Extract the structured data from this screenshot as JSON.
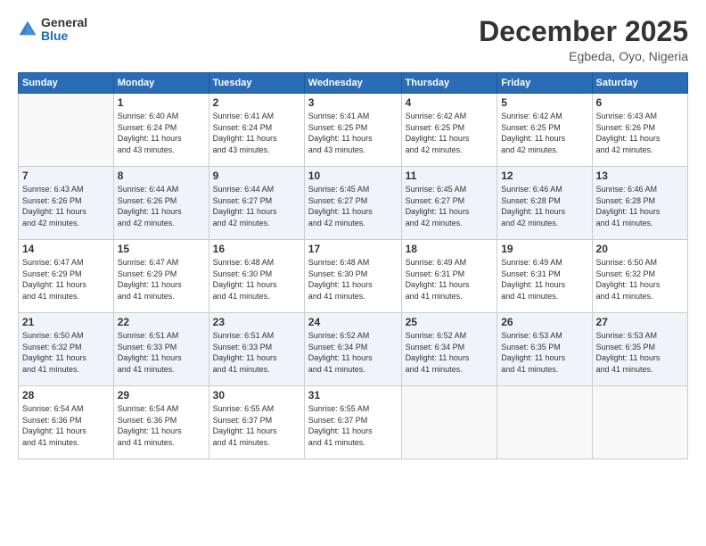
{
  "header": {
    "logo_general": "General",
    "logo_blue": "Blue",
    "month_title": "December 2025",
    "location": "Egbeda, Oyo, Nigeria"
  },
  "days_of_week": [
    "Sunday",
    "Monday",
    "Tuesday",
    "Wednesday",
    "Thursday",
    "Friday",
    "Saturday"
  ],
  "weeks": [
    [
      {
        "day": "",
        "info": ""
      },
      {
        "day": "1",
        "info": "Sunrise: 6:40 AM\nSunset: 6:24 PM\nDaylight: 11 hours\nand 43 minutes."
      },
      {
        "day": "2",
        "info": "Sunrise: 6:41 AM\nSunset: 6:24 PM\nDaylight: 11 hours\nand 43 minutes."
      },
      {
        "day": "3",
        "info": "Sunrise: 6:41 AM\nSunset: 6:25 PM\nDaylight: 11 hours\nand 43 minutes."
      },
      {
        "day": "4",
        "info": "Sunrise: 6:42 AM\nSunset: 6:25 PM\nDaylight: 11 hours\nand 42 minutes."
      },
      {
        "day": "5",
        "info": "Sunrise: 6:42 AM\nSunset: 6:25 PM\nDaylight: 11 hours\nand 42 minutes."
      },
      {
        "day": "6",
        "info": "Sunrise: 6:43 AM\nSunset: 6:26 PM\nDaylight: 11 hours\nand 42 minutes."
      }
    ],
    [
      {
        "day": "7",
        "info": "Sunrise: 6:43 AM\nSunset: 6:26 PM\nDaylight: 11 hours\nand 42 minutes."
      },
      {
        "day": "8",
        "info": "Sunrise: 6:44 AM\nSunset: 6:26 PM\nDaylight: 11 hours\nand 42 minutes."
      },
      {
        "day": "9",
        "info": "Sunrise: 6:44 AM\nSunset: 6:27 PM\nDaylight: 11 hours\nand 42 minutes."
      },
      {
        "day": "10",
        "info": "Sunrise: 6:45 AM\nSunset: 6:27 PM\nDaylight: 11 hours\nand 42 minutes."
      },
      {
        "day": "11",
        "info": "Sunrise: 6:45 AM\nSunset: 6:27 PM\nDaylight: 11 hours\nand 42 minutes."
      },
      {
        "day": "12",
        "info": "Sunrise: 6:46 AM\nSunset: 6:28 PM\nDaylight: 11 hours\nand 42 minutes."
      },
      {
        "day": "13",
        "info": "Sunrise: 6:46 AM\nSunset: 6:28 PM\nDaylight: 11 hours\nand 41 minutes."
      }
    ],
    [
      {
        "day": "14",
        "info": "Sunrise: 6:47 AM\nSunset: 6:29 PM\nDaylight: 11 hours\nand 41 minutes."
      },
      {
        "day": "15",
        "info": "Sunrise: 6:47 AM\nSunset: 6:29 PM\nDaylight: 11 hours\nand 41 minutes."
      },
      {
        "day": "16",
        "info": "Sunrise: 6:48 AM\nSunset: 6:30 PM\nDaylight: 11 hours\nand 41 minutes."
      },
      {
        "day": "17",
        "info": "Sunrise: 6:48 AM\nSunset: 6:30 PM\nDaylight: 11 hours\nand 41 minutes."
      },
      {
        "day": "18",
        "info": "Sunrise: 6:49 AM\nSunset: 6:31 PM\nDaylight: 11 hours\nand 41 minutes."
      },
      {
        "day": "19",
        "info": "Sunrise: 6:49 AM\nSunset: 6:31 PM\nDaylight: 11 hours\nand 41 minutes."
      },
      {
        "day": "20",
        "info": "Sunrise: 6:50 AM\nSunset: 6:32 PM\nDaylight: 11 hours\nand 41 minutes."
      }
    ],
    [
      {
        "day": "21",
        "info": "Sunrise: 6:50 AM\nSunset: 6:32 PM\nDaylight: 11 hours\nand 41 minutes."
      },
      {
        "day": "22",
        "info": "Sunrise: 6:51 AM\nSunset: 6:33 PM\nDaylight: 11 hours\nand 41 minutes."
      },
      {
        "day": "23",
        "info": "Sunrise: 6:51 AM\nSunset: 6:33 PM\nDaylight: 11 hours\nand 41 minutes."
      },
      {
        "day": "24",
        "info": "Sunrise: 6:52 AM\nSunset: 6:34 PM\nDaylight: 11 hours\nand 41 minutes."
      },
      {
        "day": "25",
        "info": "Sunrise: 6:52 AM\nSunset: 6:34 PM\nDaylight: 11 hours\nand 41 minutes."
      },
      {
        "day": "26",
        "info": "Sunrise: 6:53 AM\nSunset: 6:35 PM\nDaylight: 11 hours\nand 41 minutes."
      },
      {
        "day": "27",
        "info": "Sunrise: 6:53 AM\nSunset: 6:35 PM\nDaylight: 11 hours\nand 41 minutes."
      }
    ],
    [
      {
        "day": "28",
        "info": "Sunrise: 6:54 AM\nSunset: 6:36 PM\nDaylight: 11 hours\nand 41 minutes."
      },
      {
        "day": "29",
        "info": "Sunrise: 6:54 AM\nSunset: 6:36 PM\nDaylight: 11 hours\nand 41 minutes."
      },
      {
        "day": "30",
        "info": "Sunrise: 6:55 AM\nSunset: 6:37 PM\nDaylight: 11 hours\nand 41 minutes."
      },
      {
        "day": "31",
        "info": "Sunrise: 6:55 AM\nSunset: 6:37 PM\nDaylight: 11 hours\nand 41 minutes."
      },
      {
        "day": "",
        "info": ""
      },
      {
        "day": "",
        "info": ""
      },
      {
        "day": "",
        "info": ""
      }
    ]
  ]
}
